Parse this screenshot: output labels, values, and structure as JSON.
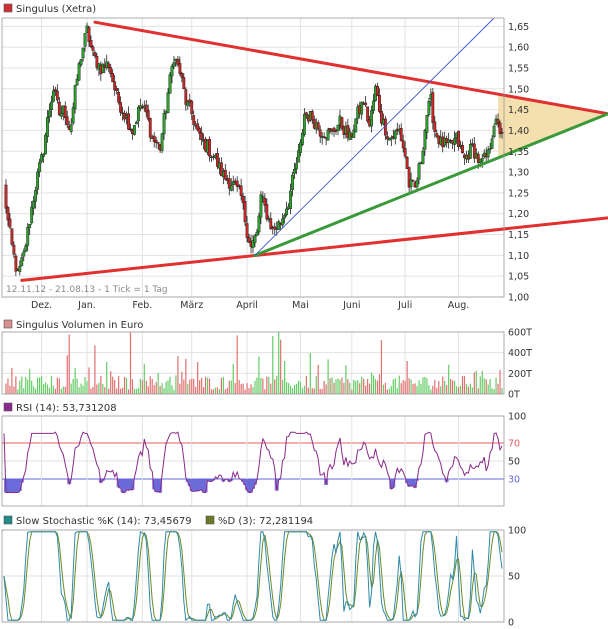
{
  "chart_data": [
    {
      "type": "candlestick",
      "title": "Singulus (Xetra)",
      "legend_color": "#d23030",
      "subtitle": "12.11.12 - 21.08.13 - 1 Tick = 1 Tag",
      "x_labels": [
        "Dez.",
        "Jan.",
        "Feb.",
        "März",
        "April",
        "Mai",
        "Juni",
        "Juli",
        "Aug."
      ],
      "y_ticks": [
        "1,65",
        "1,60",
        "1,55",
        "1,50",
        "1,45",
        "1,40",
        "1,35",
        "1,30",
        "1,25",
        "1,20",
        "1,15",
        "1,10",
        "1,05",
        "1,00"
      ],
      "ylim": [
        1.0,
        1.67
      ],
      "grid": true,
      "close_anchors": [
        {
          "d": 0,
          "v": 1.26
        },
        {
          "d": 4,
          "v": 1.18
        },
        {
          "d": 8,
          "v": 1.12
        },
        {
          "d": 14,
          "v": 1.05
        },
        {
          "d": 20,
          "v": 1.1
        },
        {
          "d": 27,
          "v": 1.2
        },
        {
          "d": 33,
          "v": 1.28
        },
        {
          "d": 39,
          "v": 1.34
        },
        {
          "d": 45,
          "v": 1.44
        },
        {
          "d": 50,
          "v": 1.5
        },
        {
          "d": 56,
          "v": 1.44
        },
        {
          "d": 61,
          "v": 1.45
        },
        {
          "d": 67,
          "v": 1.4
        },
        {
          "d": 73,
          "v": 1.51
        },
        {
          "d": 78,
          "v": 1.58
        },
        {
          "d": 84,
          "v": 1.64
        },
        {
          "d": 90,
          "v": 1.58
        },
        {
          "d": 98,
          "v": 1.55
        },
        {
          "d": 106,
          "v": 1.56
        },
        {
          "d": 114,
          "v": 1.48
        },
        {
          "d": 122,
          "v": 1.44
        },
        {
          "d": 130,
          "v": 1.4
        },
        {
          "d": 138,
          "v": 1.46
        },
        {
          "d": 144,
          "v": 1.44
        },
        {
          "d": 150,
          "v": 1.38
        },
        {
          "d": 158,
          "v": 1.36
        },
        {
          "d": 166,
          "v": 1.49
        },
        {
          "d": 172,
          "v": 1.58
        },
        {
          "d": 178,
          "v": 1.54
        },
        {
          "d": 184,
          "v": 1.47
        },
        {
          "d": 190,
          "v": 1.44
        },
        {
          "d": 198,
          "v": 1.38
        },
        {
          "d": 206,
          "v": 1.36
        },
        {
          "d": 214,
          "v": 1.33
        },
        {
          "d": 222,
          "v": 1.29
        },
        {
          "d": 232,
          "v": 1.27
        },
        {
          "d": 240,
          "v": 1.24
        },
        {
          "d": 246,
          "v": 1.16
        },
        {
          "d": 250,
          "v": 1.12
        },
        {
          "d": 256,
          "v": 1.15
        },
        {
          "d": 260,
          "v": 1.24
        },
        {
          "d": 266,
          "v": 1.2
        },
        {
          "d": 272,
          "v": 1.16
        },
        {
          "d": 280,
          "v": 1.18
        },
        {
          "d": 288,
          "v": 1.23
        },
        {
          "d": 294,
          "v": 1.3
        },
        {
          "d": 300,
          "v": 1.36
        },
        {
          "d": 304,
          "v": 1.44
        },
        {
          "d": 312,
          "v": 1.43
        },
        {
          "d": 320,
          "v": 1.4
        },
        {
          "d": 330,
          "v": 1.39
        },
        {
          "d": 340,
          "v": 1.42
        },
        {
          "d": 350,
          "v": 1.38
        },
        {
          "d": 358,
          "v": 1.44
        },
        {
          "d": 364,
          "v": 1.47
        },
        {
          "d": 370,
          "v": 1.41
        },
        {
          "d": 376,
          "v": 1.5
        },
        {
          "d": 382,
          "v": 1.43
        },
        {
          "d": 390,
          "v": 1.38
        },
        {
          "d": 400,
          "v": 1.4
        },
        {
          "d": 406,
          "v": 1.34
        },
        {
          "d": 410,
          "v": 1.27
        },
        {
          "d": 416,
          "v": 1.26
        },
        {
          "d": 422,
          "v": 1.33
        },
        {
          "d": 428,
          "v": 1.44
        },
        {
          "d": 432,
          "v": 1.47
        },
        {
          "d": 436,
          "v": 1.4
        },
        {
          "d": 442,
          "v": 1.37
        },
        {
          "d": 450,
          "v": 1.36
        },
        {
          "d": 458,
          "v": 1.38
        },
        {
          "d": 466,
          "v": 1.33
        },
        {
          "d": 474,
          "v": 1.36
        },
        {
          "d": 482,
          "v": 1.32
        },
        {
          "d": 490,
          "v": 1.34
        },
        {
          "d": 496,
          "v": 1.42
        },
        {
          "d": 502,
          "v": 1.4
        }
      ],
      "trend_lines": [
        {
          "color": "#e03030",
          "from": [
            92,
            1.66
          ],
          "to": [
            608,
            1.44
          ]
        },
        {
          "color": "#e03030",
          "from": [
            18,
            1.04
          ],
          "to": [
            608,
            1.19
          ]
        },
        {
          "color": "#3a9a3a",
          "from": [
            254,
            1.1
          ],
          "to": [
            608,
            1.44
          ]
        },
        {
          "color": "#3f57c8",
          "from": [
            254,
            1.1
          ],
          "to": [
            496,
            1.67
          ]
        }
      ],
      "triangle_fill": "#f3dda5"
    },
    {
      "type": "bar",
      "title": "Singulus Volumen in Euro",
      "legend_color": "#d89090",
      "y_ticks": [
        "600T",
        "400T",
        "200T",
        "0T"
      ],
      "ylim": [
        0,
        600
      ],
      "bar_colors": [
        "#e07070",
        "#66cc66"
      ]
    },
    {
      "type": "line",
      "title": "RSI (14): 53,731208",
      "legend_color": "#8a2a8a",
      "y_ticks": [
        "100",
        "70",
        "50",
        "30"
      ],
      "ylim": [
        0,
        100
      ],
      "upper_band": 70,
      "lower_band": 30,
      "upper_color": "#e06060",
      "lower_color": "#6666d8",
      "line_color": "#8a2a8a"
    },
    {
      "type": "line",
      "title_k": "Slow Stochastic %K (14): 73,45679",
      "title_d": "%D (3): 72,281194",
      "legend_color_k": "#1e8a8a",
      "legend_color_d": "#6a7a2a",
      "y_ticks": [
        "100",
        "50",
        "0"
      ],
      "ylim": [
        0,
        100
      ],
      "k_color": "#2f8aa8",
      "d_color": "#6a8a2a"
    }
  ]
}
